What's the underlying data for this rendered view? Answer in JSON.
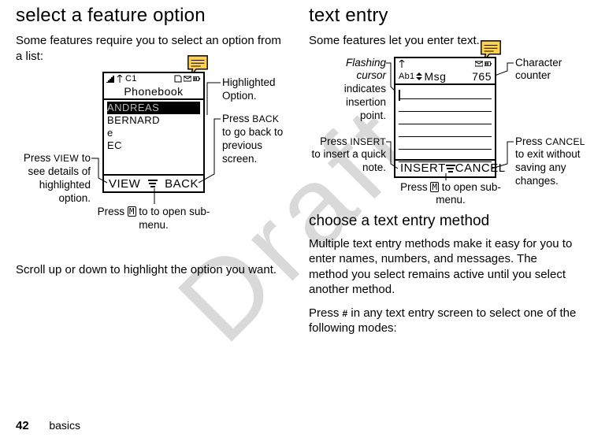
{
  "left": {
    "heading": "select a feature option",
    "intro": "Some features require you to select an option from a list:",
    "phone": {
      "status_c1": "C1",
      "title": "Phonebook",
      "items": [
        "ANDREAS",
        "BERNARD",
        "e",
        "EC"
      ],
      "soft_left": "VIEW",
      "soft_right": "BACK"
    },
    "callouts": {
      "highlighted": "Highlighted Option.",
      "back": [
        "Press ",
        "BACK",
        " to go back to previous screen."
      ],
      "view": [
        "Press ",
        "VIEW",
        " to see details of highlighted option."
      ],
      "menu": [
        "Press ",
        "M",
        " to to open sub-menu."
      ]
    },
    "after": "Scroll up or down to highlight the option you want."
  },
  "right": {
    "heading": "text entry",
    "intro": "Some features let you enter text.",
    "phone": {
      "status_ab": "Ab1",
      "title": "Msg",
      "counter": "765",
      "soft_left": "INSERT",
      "soft_right": "CANCEL"
    },
    "callouts": {
      "cursorA": "Flashing cursor",
      "cursorB": " indicates insertion point.",
      "counter": "Character counter",
      "insert": [
        "Press ",
        "INSERT",
        " to insert a quick note."
      ],
      "cancel": [
        "Press ",
        "CANCEL",
        " to exit without saving any changes."
      ],
      "menu": [
        "Press ",
        "M",
        " to open sub-menu."
      ]
    },
    "subhead": "choose a text entry method",
    "para1": "Multiple text entry methods make it easy for you to enter names, numbers, and messages. The method you select remains active until you select another method.",
    "para2a": "Press ",
    "para2b": "#",
    "para2c": " in any text entry screen to select one of the following modes:"
  },
  "footer": {
    "page": "42",
    "section": "basics"
  },
  "watermark": "Draft"
}
